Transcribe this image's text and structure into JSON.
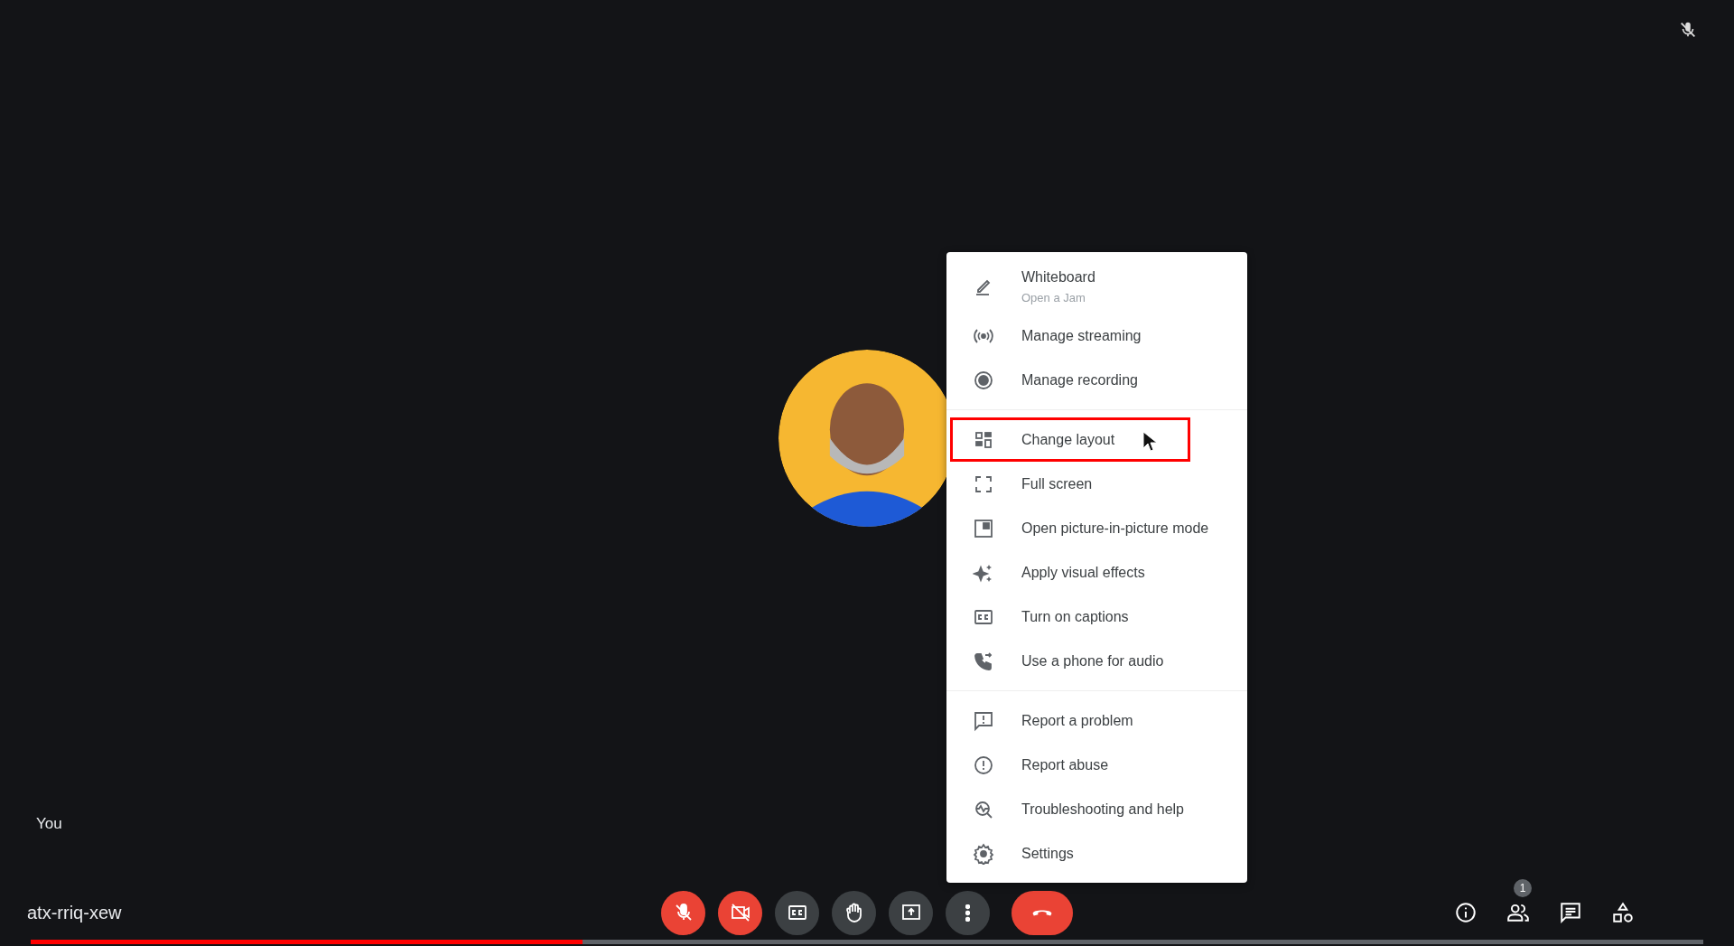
{
  "stage": {
    "self_label": "You",
    "remote_mic_muted": true
  },
  "menu": {
    "sections": [
      [
        {
          "label": "Whiteboard",
          "sublabel": "Open a Jam",
          "highlighted": false
        },
        {
          "label": "Manage streaming",
          "highlighted": false
        },
        {
          "label": "Manage recording",
          "highlighted": false
        }
      ],
      [
        {
          "label": "Change layout",
          "highlighted": true
        },
        {
          "label": "Full screen",
          "highlighted": false
        },
        {
          "label": "Open picture-in-picture mode",
          "highlighted": false
        },
        {
          "label": "Apply visual effects",
          "highlighted": false
        },
        {
          "label": "Turn on captions",
          "highlighted": false
        },
        {
          "label": "Use a phone for audio",
          "highlighted": false
        }
      ],
      [
        {
          "label": "Report a problem",
          "highlighted": false
        },
        {
          "label": "Report abuse",
          "highlighted": false
        },
        {
          "label": "Troubleshooting and help",
          "highlighted": false
        },
        {
          "label": "Settings",
          "highlighted": false
        }
      ]
    ]
  },
  "meeting_code": "atx-rriq-xew",
  "controls": [
    {
      "kind": "toggle",
      "off": true
    },
    {
      "kind": "toggle",
      "off": true
    },
    {
      "kind": "toggle",
      "off": false
    },
    {
      "kind": "toggle",
      "off": false
    },
    {
      "kind": "toggle",
      "off": false
    },
    {
      "kind": "toggle",
      "off": false
    },
    {
      "kind": "end"
    }
  ],
  "participants_badge": "1",
  "video_progress": {
    "level": 0.33
  }
}
